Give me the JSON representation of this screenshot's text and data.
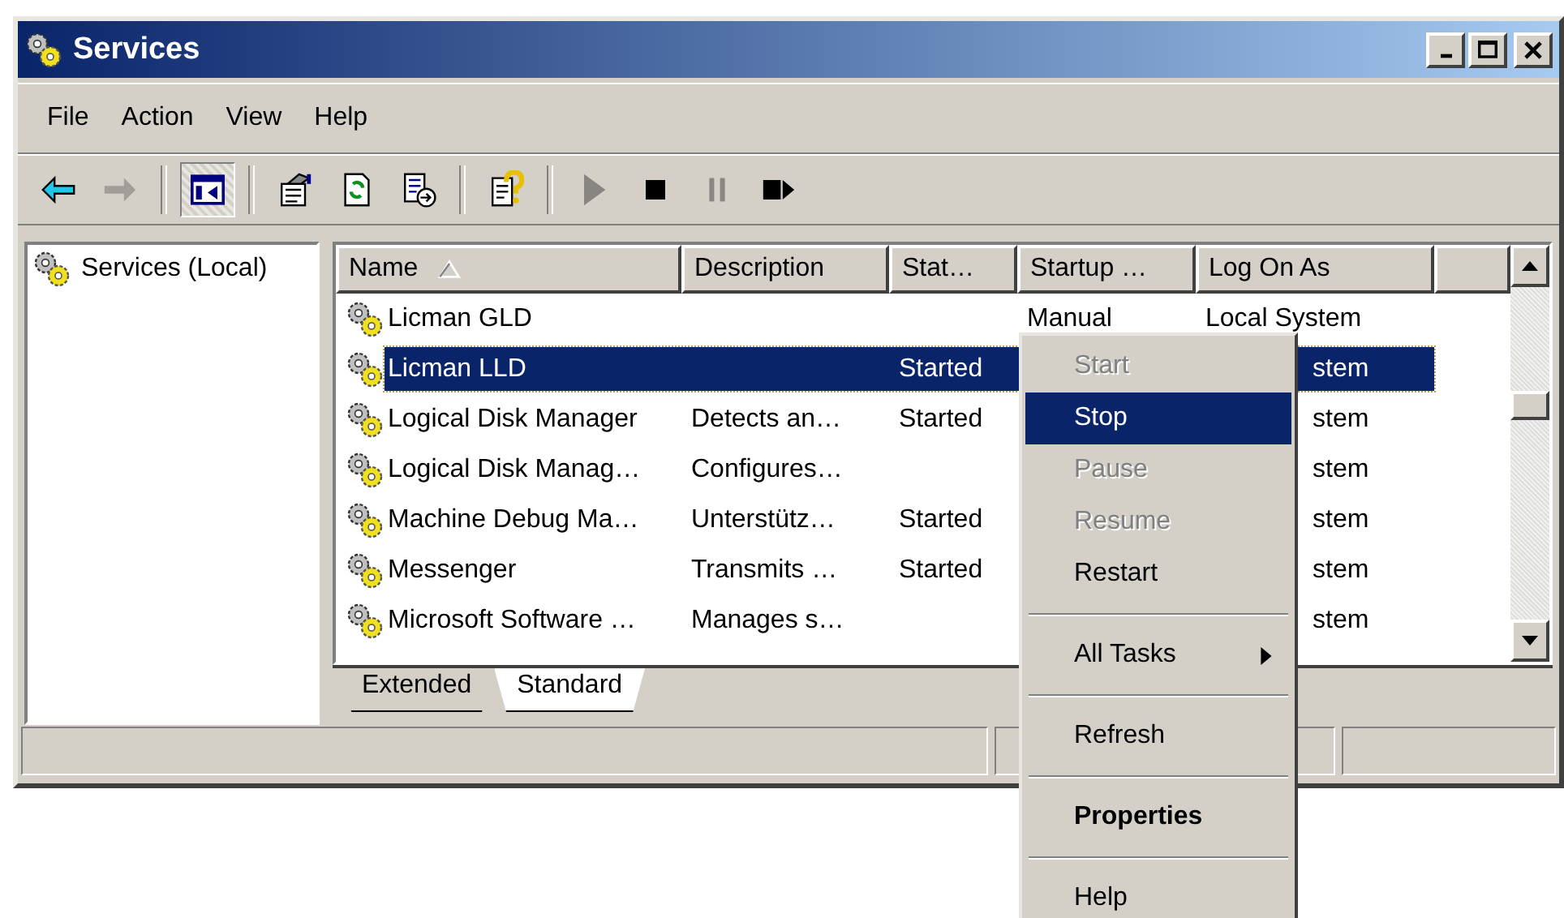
{
  "window": {
    "title": "Services"
  },
  "menu_bar": [
    "File",
    "Action",
    "View",
    "Help"
  ],
  "toolbar": [
    {
      "kind": "back",
      "disabled": false,
      "pressed": false
    },
    {
      "kind": "forward",
      "disabled": true,
      "pressed": false
    },
    {
      "kind": "separator"
    },
    {
      "kind": "tree",
      "disabled": false,
      "pressed": true
    },
    {
      "kind": "separator"
    },
    {
      "kind": "properties",
      "disabled": false,
      "pressed": false
    },
    {
      "kind": "refresh",
      "disabled": false,
      "pressed": false
    },
    {
      "kind": "export",
      "disabled": false,
      "pressed": false
    },
    {
      "kind": "separator"
    },
    {
      "kind": "help",
      "disabled": false,
      "pressed": false
    },
    {
      "kind": "separator"
    },
    {
      "kind": "play",
      "disabled": true,
      "pressed": false
    },
    {
      "kind": "stop",
      "disabled": false,
      "pressed": false
    },
    {
      "kind": "pause",
      "disabled": true,
      "pressed": false
    },
    {
      "kind": "restart",
      "disabled": false,
      "pressed": false
    }
  ],
  "tree": {
    "items": [
      {
        "label": "Services (Local)"
      }
    ]
  },
  "table": {
    "columns": [
      {
        "label": "Name",
        "sorted": true
      },
      {
        "label": "Description",
        "sorted": false
      },
      {
        "label": "Stat…",
        "sorted": false
      },
      {
        "label": "Startup …",
        "sorted": false
      },
      {
        "label": "Log On As",
        "sorted": false
      }
    ],
    "rows": [
      {
        "name": "Licman GLD",
        "startup": "Manual",
        "log_on_as": "Local System",
        "selected": false,
        "covered": false
      },
      {
        "name": "Licman LLD",
        "status": "Started",
        "log_on_as": "stem",
        "selected": true,
        "covered": true
      },
      {
        "name": "Logical Disk Manager",
        "description": "Detects an…",
        "status": "Started",
        "log_on_as": "stem",
        "selected": false,
        "covered": true
      },
      {
        "name": "Logical Disk Manag…",
        "description": "Configures…",
        "log_on_as": "stem",
        "selected": false,
        "covered": true
      },
      {
        "name": "Machine Debug Ma…",
        "description": "Unterstütz…",
        "status": "Started",
        "log_on_as": "stem",
        "selected": false,
        "covered": true
      },
      {
        "name": "Messenger",
        "description": "Transmits …",
        "status": "Started",
        "log_on_as": "stem",
        "selected": false,
        "covered": true
      },
      {
        "name": "Microsoft Software …",
        "description": "Manages s…",
        "log_on_as": "stem",
        "selected": false,
        "covered": true
      }
    ]
  },
  "view_tabs": [
    {
      "label": "Extended",
      "selected": false
    },
    {
      "label": "Standard",
      "selected": true
    }
  ],
  "context_menu": [
    {
      "kind": "item",
      "label": "Start",
      "disabled": true,
      "selected": false,
      "bold": false
    },
    {
      "kind": "item",
      "label": "Stop",
      "disabled": false,
      "selected": true,
      "bold": false
    },
    {
      "kind": "item",
      "label": "Pause",
      "disabled": true,
      "selected": false,
      "bold": false
    },
    {
      "kind": "item",
      "label": "Resume",
      "disabled": true,
      "selected": false,
      "bold": false
    },
    {
      "kind": "item",
      "label": "Restart",
      "disabled": false,
      "selected": false,
      "bold": false
    },
    {
      "kind": "separator"
    },
    {
      "kind": "submenu",
      "label": "All Tasks",
      "disabled": false,
      "selected": false,
      "bold": false
    },
    {
      "kind": "separator"
    },
    {
      "kind": "item",
      "label": "Refresh",
      "disabled": false,
      "selected": false,
      "bold": false
    },
    {
      "kind": "separator"
    },
    {
      "kind": "item",
      "label": "Properties",
      "disabled": false,
      "selected": false,
      "bold": true
    },
    {
      "kind": "separator"
    },
    {
      "kind": "item",
      "label": "Help",
      "disabled": false,
      "selected": false,
      "bold": false
    }
  ]
}
